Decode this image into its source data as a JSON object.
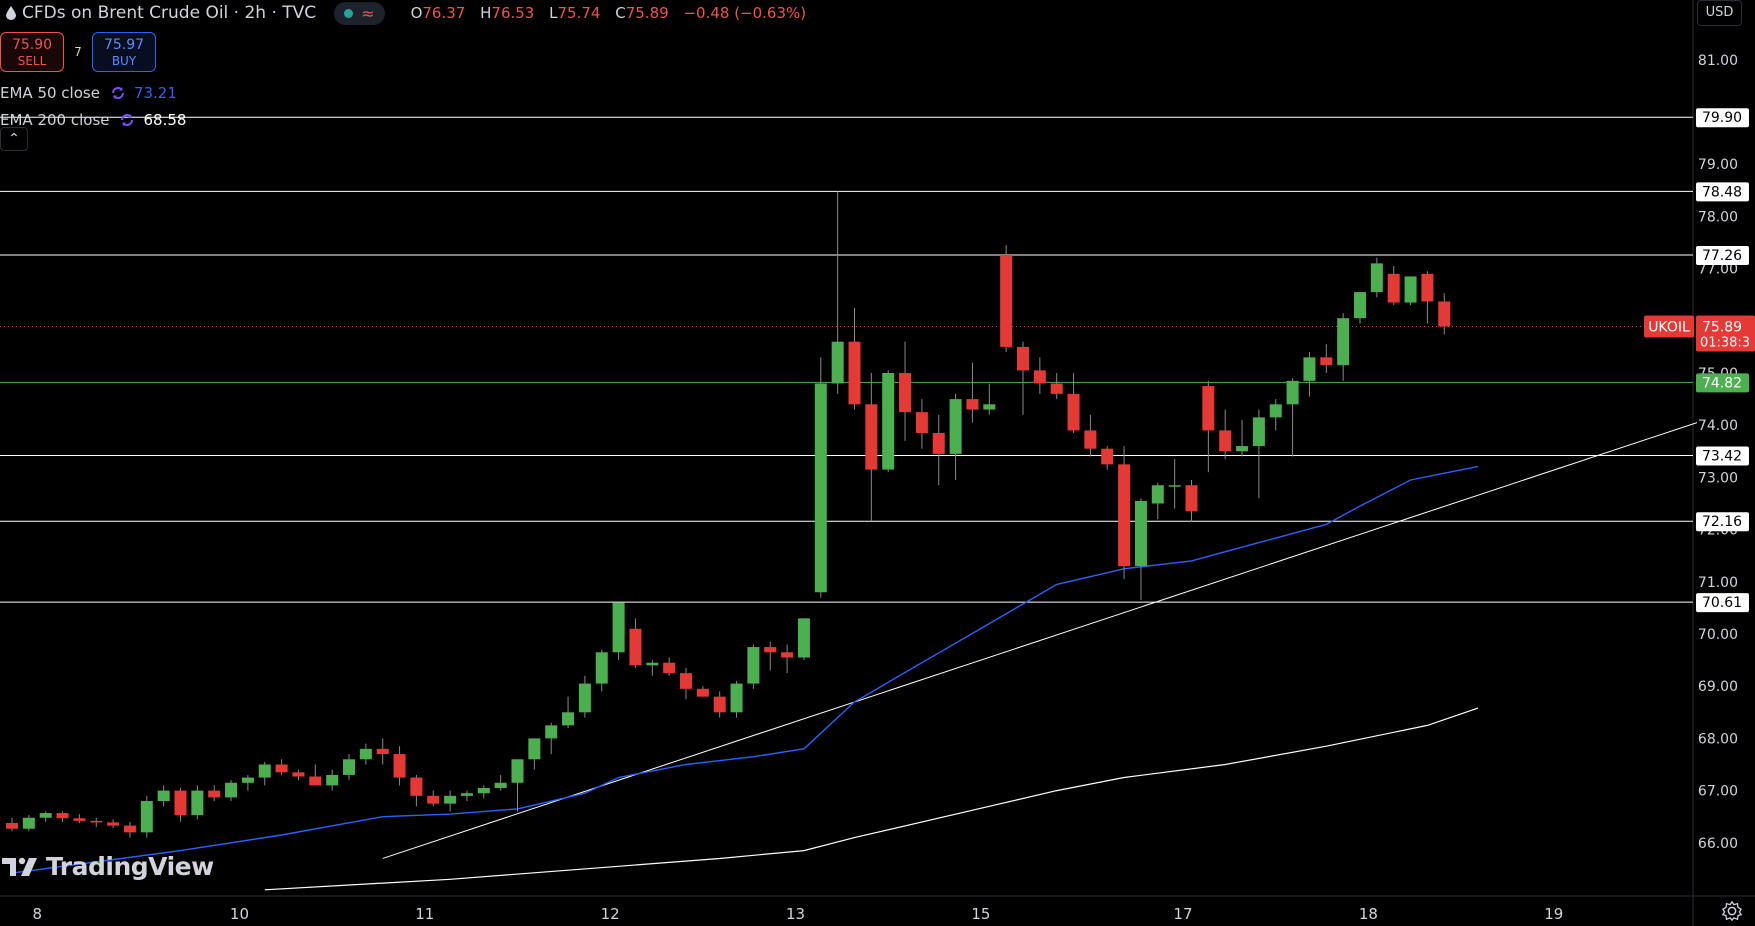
{
  "header": {
    "symbol_title": "CFDs on Brent Crude Oil · 2h · TVC",
    "ohlc": [
      {
        "k": "O",
        "v": "76.37"
      },
      {
        "k": "H",
        "v": "76.53"
      },
      {
        "k": "L",
        "v": "75.74"
      },
      {
        "k": "C",
        "v": "75.89"
      },
      {
        "k": "",
        "v": "−0.48 (−0.63%)"
      }
    ],
    "status_colors": {
      "live": "#26a69a",
      "wave": "#ef5350"
    }
  },
  "trade": {
    "sell_price": "75.90",
    "sell_label": "SELL",
    "spread": "7",
    "buy_price": "75.97",
    "buy_label": "BUY"
  },
  "indicators": [
    {
      "label": "EMA 50 close",
      "value": "73.21",
      "color": "#2962ff"
    },
    {
      "label": "EMA 200 close",
      "value": "68.58",
      "color": "#ffffff"
    }
  ],
  "currency": "USD",
  "branding": "TradingView",
  "chart_data": {
    "type": "candlestick",
    "title": "CFDs on Brent Crude Oil · 2h · TVC",
    "ylim": [
      65.13,
      81.74
    ],
    "y_ticks": [
      "66.00",
      "67.00",
      "68.00",
      "69.00",
      "70.00",
      "71.00",
      "72.00",
      "73.00",
      "74.00",
      "75.00",
      "76.00",
      "77.00",
      "78.00",
      "79.00",
      "81.00"
    ],
    "x_ticks": [
      {
        "label": "8",
        "i": 1.5
      },
      {
        "label": "10",
        "i": 13.5
      },
      {
        "label": "11",
        "i": 24.5
      },
      {
        "label": "12",
        "i": 35.5
      },
      {
        "label": "13",
        "i": 46.5
      },
      {
        "label": "15",
        "i": 57.5
      },
      {
        "label": "17",
        "i": 69.5
      },
      {
        "label": "18",
        "i": 80.5
      },
      {
        "label": "19",
        "i": 91.5
      }
    ],
    "candles": [
      [
        66.38,
        66.48,
        66.22,
        66.27
      ],
      [
        66.27,
        66.53,
        66.22,
        66.48
      ],
      [
        66.48,
        66.6,
        66.4,
        66.57
      ],
      [
        66.57,
        66.6,
        66.4,
        66.47
      ],
      [
        66.47,
        66.55,
        66.38,
        66.42
      ],
      [
        66.42,
        66.48,
        66.3,
        66.39
      ],
      [
        66.39,
        66.45,
        66.28,
        66.33
      ],
      [
        66.33,
        66.4,
        66.1,
        66.2
      ],
      [
        66.2,
        66.9,
        66.1,
        66.8
      ],
      [
        66.8,
        67.1,
        66.7,
        67.0
      ],
      [
        67.0,
        67.05,
        66.4,
        66.53
      ],
      [
        66.53,
        67.1,
        66.45,
        67.0
      ],
      [
        67.0,
        67.1,
        66.8,
        66.87
      ],
      [
        66.87,
        67.2,
        66.8,
        67.15
      ],
      [
        67.15,
        67.3,
        67.0,
        67.25
      ],
      [
        67.25,
        67.55,
        67.1,
        67.5
      ],
      [
        67.5,
        67.6,
        67.3,
        67.35
      ],
      [
        67.35,
        67.4,
        67.2,
        67.27
      ],
      [
        67.27,
        67.5,
        67.1,
        67.1
      ],
      [
        67.1,
        67.4,
        67.0,
        67.3
      ],
      [
        67.3,
        67.7,
        67.2,
        67.6
      ],
      [
        67.6,
        67.9,
        67.5,
        67.8
      ],
      [
        67.8,
        68.0,
        67.5,
        67.7
      ],
      [
        67.7,
        67.85,
        67.1,
        67.25
      ],
      [
        67.25,
        67.3,
        66.7,
        66.9
      ],
      [
        66.9,
        67.0,
        66.7,
        66.75
      ],
      [
        66.75,
        67.0,
        66.6,
        66.9
      ],
      [
        66.9,
        67.0,
        66.8,
        66.95
      ],
      [
        66.95,
        67.1,
        66.85,
        67.05
      ],
      [
        67.05,
        67.3,
        67.0,
        67.15
      ],
      [
        67.15,
        67.6,
        66.6,
        67.6
      ],
      [
        67.6,
        68.0,
        67.4,
        68.0
      ],
      [
        68.0,
        68.3,
        67.7,
        68.25
      ],
      [
        68.25,
        68.8,
        68.2,
        68.5
      ],
      [
        68.5,
        69.2,
        68.4,
        69.05
      ],
      [
        69.05,
        69.7,
        68.9,
        69.65
      ],
      [
        69.65,
        70.6,
        69.5,
        70.6
      ],
      [
        70.1,
        70.3,
        69.35,
        69.4
      ],
      [
        69.4,
        69.5,
        69.2,
        69.45
      ],
      [
        69.45,
        69.55,
        69.2,
        69.25
      ],
      [
        69.25,
        69.35,
        68.75,
        68.95
      ],
      [
        68.95,
        69.0,
        68.8,
        68.8
      ],
      [
        68.8,
        68.9,
        68.4,
        68.5
      ],
      [
        68.5,
        69.1,
        68.4,
        69.05
      ],
      [
        69.05,
        69.8,
        68.95,
        69.75
      ],
      [
        69.75,
        69.85,
        69.3,
        69.65
      ],
      [
        69.65,
        69.8,
        69.25,
        69.55
      ],
      [
        69.55,
        70.3,
        69.5,
        70.3
      ],
      [
        70.8,
        75.3,
        70.7,
        74.8
      ],
      [
        74.8,
        78.48,
        74.6,
        75.6
      ],
      [
        75.6,
        76.25,
        74.3,
        74.4
      ],
      [
        74.4,
        75.0,
        72.16,
        73.15
      ],
      [
        73.15,
        75.05,
        73.1,
        75.0
      ],
      [
        75.0,
        75.6,
        73.7,
        74.25
      ],
      [
        74.25,
        74.5,
        73.55,
        73.85
      ],
      [
        73.85,
        74.2,
        72.85,
        73.45
      ],
      [
        73.45,
        74.6,
        72.95,
        74.5
      ],
      [
        74.5,
        75.2,
        74.05,
        74.3
      ],
      [
        74.3,
        74.8,
        74.2,
        74.4
      ],
      [
        77.26,
        77.45,
        75.4,
        75.5
      ],
      [
        75.5,
        75.6,
        74.2,
        75.05
      ],
      [
        75.05,
        75.3,
        74.6,
        74.8
      ],
      [
        74.8,
        75.0,
        74.5,
        74.6
      ],
      [
        74.6,
        75.0,
        73.85,
        73.9
      ],
      [
        73.9,
        74.2,
        73.4,
        73.55
      ],
      [
        73.55,
        73.6,
        73.15,
        73.25
      ],
      [
        73.25,
        73.6,
        71.05,
        71.3
      ],
      [
        71.3,
        72.6,
        70.65,
        72.55
      ],
      [
        72.5,
        72.9,
        72.2,
        72.85
      ],
      [
        72.85,
        73.35,
        72.4,
        72.85
      ],
      [
        72.85,
        72.95,
        72.15,
        72.35
      ],
      [
        74.75,
        74.85,
        73.1,
        73.9
      ],
      [
        73.9,
        74.3,
        73.35,
        73.5
      ],
      [
        73.5,
        74.1,
        73.4,
        73.6
      ],
      [
        73.6,
        74.3,
        72.6,
        74.15
      ],
      [
        74.15,
        74.5,
        73.9,
        74.4
      ],
      [
        74.4,
        74.9,
        73.4,
        74.85
      ],
      [
        74.85,
        75.4,
        74.55,
        75.3
      ],
      [
        75.3,
        75.55,
        75.0,
        75.15
      ],
      [
        75.15,
        76.15,
        74.85,
        76.05
      ],
      [
        76.05,
        76.55,
        75.95,
        76.55
      ],
      [
        76.55,
        77.21,
        76.45,
        77.1
      ],
      [
        76.9,
        77.05,
        76.3,
        76.35
      ],
      [
        76.35,
        76.8,
        76.3,
        76.85
      ],
      [
        76.9,
        76.95,
        75.95,
        76.37
      ],
      [
        76.37,
        76.53,
        75.74,
        75.89
      ]
    ],
    "ema50": [
      [
        0,
        65.42
      ],
      [
        10,
        65.85
      ],
      [
        16,
        66.15
      ],
      [
        22,
        66.5
      ],
      [
        26,
        66.55
      ],
      [
        30,
        66.65
      ],
      [
        34,
        66.95
      ],
      [
        36,
        67.25
      ],
      [
        40,
        67.5
      ],
      [
        44,
        67.65
      ],
      [
        47,
        67.8
      ],
      [
        50,
        68.7
      ],
      [
        54,
        69.45
      ],
      [
        58,
        70.2
      ],
      [
        62,
        70.95
      ],
      [
        66,
        71.25
      ],
      [
        70,
        71.4
      ],
      [
        74,
        71.75
      ],
      [
        78,
        72.1
      ],
      [
        80,
        72.45
      ],
      [
        83,
        72.95
      ],
      [
        87,
        73.21
      ]
    ],
    "ema200": [
      [
        15,
        65.1
      ],
      [
        26,
        65.3
      ],
      [
        36,
        65.55
      ],
      [
        42,
        65.7
      ],
      [
        47,
        65.85
      ],
      [
        50,
        66.1
      ],
      [
        58,
        66.7
      ],
      [
        62,
        67.0
      ],
      [
        66,
        67.25
      ],
      [
        72,
        67.5
      ],
      [
        78,
        67.85
      ],
      [
        84,
        68.25
      ],
      [
        87,
        68.58
      ]
    ],
    "trendline": [
      [
        22,
        65.7
      ],
      [
        100,
        74.05
      ]
    ],
    "levels": [
      {
        "value": 79.9,
        "label": "79.90",
        "color": "#ffffff"
      },
      {
        "value": 78.48,
        "label": "78.48",
        "color": "#ffffff"
      },
      {
        "value": 77.26,
        "label": "77.26",
        "color": "#ffffff"
      },
      {
        "value": 74.82,
        "label": "74.82",
        "color": "#4caf50"
      },
      {
        "value": 73.42,
        "label": "73.42",
        "color": "#ffffff"
      },
      {
        "value": 72.16,
        "label": "72.16",
        "color": "#ffffff"
      },
      {
        "value": 70.61,
        "label": "70.61",
        "color": "#ffffff"
      }
    ],
    "last_price": {
      "symbol": "UKOIL",
      "value": 75.89,
      "label": "75.89",
      "countdown": "01:38:3",
      "color": "#e53935"
    },
    "colors": {
      "up": "#4caf50",
      "down": "#e53935",
      "ema50": "#2962ff",
      "ema200": "#ffffff",
      "trend": "#ffffff"
    }
  }
}
